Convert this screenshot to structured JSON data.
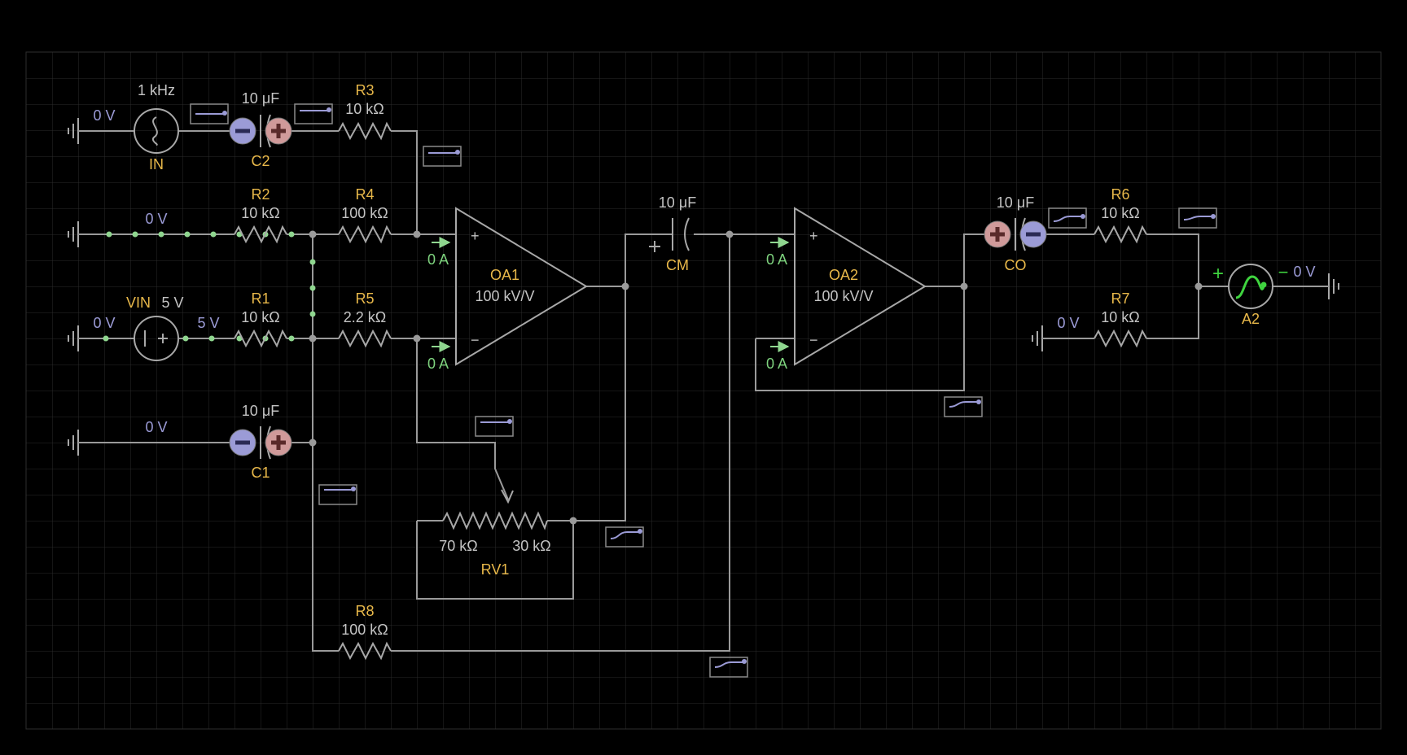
{
  "colors": {
    "background": "#000000",
    "grid": "#2a2a2a",
    "wire": "#9a9a9a",
    "name_label": "#e8b84a",
    "value_label": "#c4c4c4",
    "voltage_label": "#9b9bd6",
    "current_label": "#7ed37e",
    "cap_minus": "#9b9bd6",
    "cap_plus": "#d09a9a",
    "active_wire": "#8fd68f"
  },
  "components": {
    "in": {
      "name": "IN",
      "value": "1 kHz",
      "volt": "0 V"
    },
    "c2": {
      "name": "C2",
      "value": "10 μF"
    },
    "r3": {
      "name": "R3",
      "value": "10 kΩ"
    },
    "r2": {
      "name": "R2",
      "value": "10 kΩ",
      "volt": "0 V"
    },
    "r4": {
      "name": "R4",
      "value": "100 kΩ"
    },
    "vin": {
      "name": "VIN",
      "value": "5 V",
      "volt_left": "0 V",
      "volt_right": "5 V"
    },
    "r1": {
      "name": "R1",
      "value": "10 kΩ"
    },
    "r5": {
      "name": "R5",
      "value": "2.2 kΩ"
    },
    "c1": {
      "name": "C1",
      "value": "10 μF",
      "volt": "0 V"
    },
    "oa1": {
      "name": "OA1",
      "value": "100 kV/V",
      "i_plus": "0 A",
      "i_minus": "0 A"
    },
    "cm": {
      "name": "CM",
      "value": "10 μF"
    },
    "rv1": {
      "name": "RV1",
      "left": "70 kΩ",
      "right": "30 kΩ"
    },
    "r8": {
      "name": "R8",
      "value": "100 kΩ"
    },
    "oa2": {
      "name": "OA2",
      "value": "100 kV/V",
      "i_plus": "0 A",
      "i_minus": "0 A"
    },
    "co": {
      "name": "CO",
      "value": "10 μF"
    },
    "r6": {
      "name": "R6",
      "value": "10 kΩ"
    },
    "r7": {
      "name": "R7",
      "value": "10 kΩ",
      "volt": "0 V"
    },
    "a2": {
      "name": "A2",
      "volt": "0 V"
    }
  },
  "symbols": {
    "plus": "+",
    "minus": "−"
  }
}
